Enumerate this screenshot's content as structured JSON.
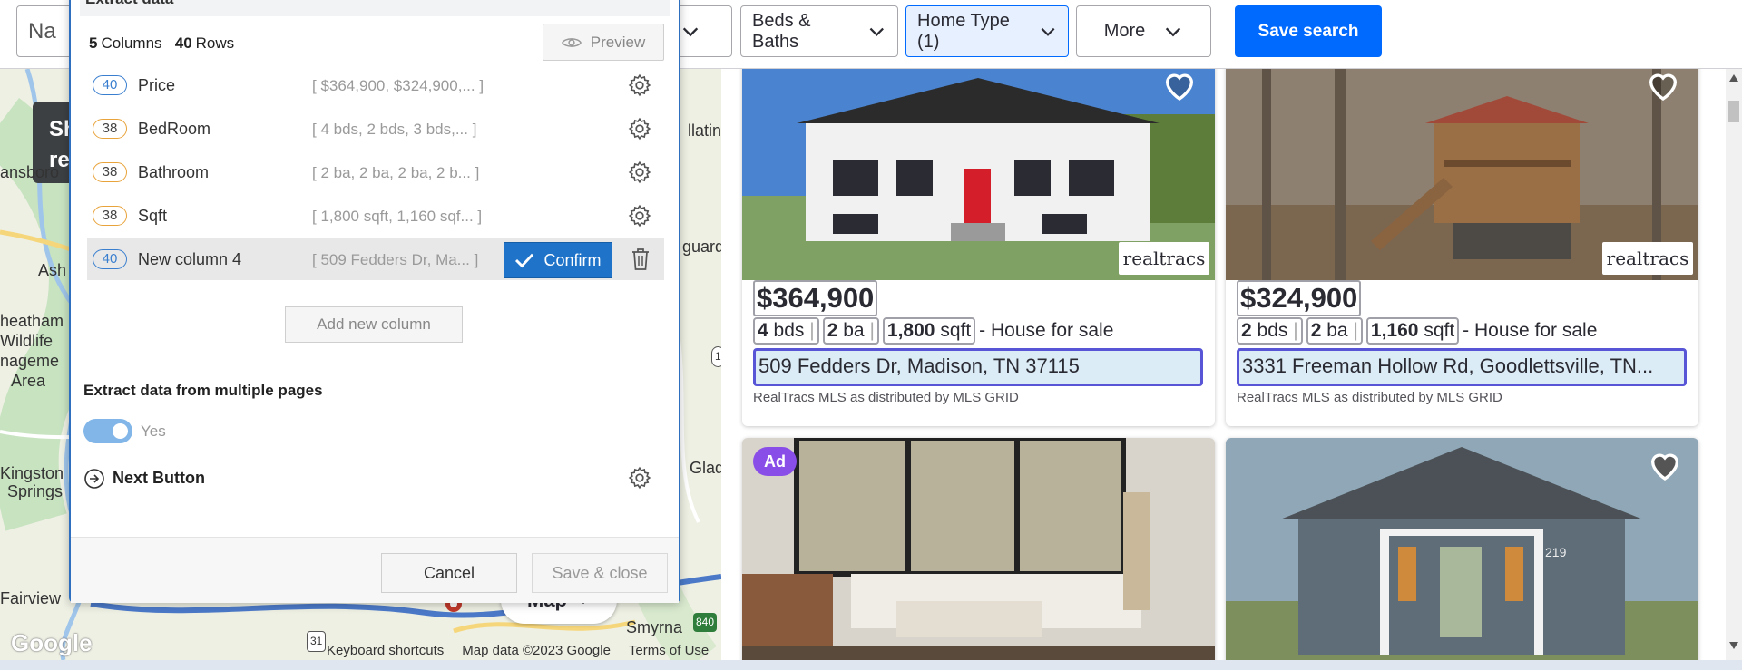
{
  "filters": {
    "location_partial": "Na",
    "beds_baths": "Beds & Baths",
    "home_type": "Home Type (1)",
    "more": "More",
    "save_search": "Save search"
  },
  "map": {
    "places": [
      "ansboro",
      "Ash",
      "heatham",
      "Wildlife",
      "nageme",
      "Area",
      "Kingston",
      "Springs",
      "Fairview",
      "llatin",
      "guard",
      "Glad",
      "Smyrna"
    ],
    "tooltip_lines": [
      "Sh",
      "re"
    ],
    "route_badges": [
      "31",
      "840",
      "1"
    ],
    "map_button": "Map",
    "google_logo": "Google",
    "credits": [
      "Keyboard shortcuts",
      "Map data ©2023 Google",
      "Terms of Use"
    ]
  },
  "listings": [
    {
      "price": "$364,900",
      "beds": "4",
      "beds_unit": "bds",
      "baths": "2",
      "baths_unit": "ba",
      "sqft": "1,800",
      "sqft_unit": "sqft",
      "status": "- House for sale",
      "address": "509 Fedders Dr, Madison, TN 37115",
      "mls": "RealTracs MLS as distributed by MLS GRID",
      "brand": "realtracs",
      "icon": "heart-outline-icon"
    },
    {
      "price": "$324,900",
      "beds": "2",
      "beds_unit": "bds",
      "baths": "2",
      "baths_unit": "ba",
      "sqft": "1,160",
      "sqft_unit": "sqft",
      "status": "- House for sale",
      "address": "3331 Freeman Hollow Rd, Goodlettsville, TN...",
      "mls": "RealTracs MLS as distributed by MLS GRID",
      "brand": "realtracs",
      "icon": "heart-outline-icon"
    },
    {
      "ad_badge": "Ad"
    },
    {
      "house_number": "219",
      "icon": "heart-filled-icon"
    }
  ],
  "panel": {
    "title": "Extract data",
    "columns_count": "5",
    "columns_label": "Columns",
    "rows_count": "40",
    "rows_label": "Rows",
    "preview": "Preview",
    "columns": [
      {
        "count": "40",
        "name": "Price",
        "sample": "[ $364,900, $324,900,... ]",
        "color": "#3a7fcf"
      },
      {
        "count": "38",
        "name": "BedRoom",
        "sample": "[ 4 bds, 2 bds, 3 bds,... ]",
        "color": "#e8a33a"
      },
      {
        "count": "38",
        "name": "Bathroom",
        "sample": "[ 2 ba, 2 ba, 2 ba, 2 b... ]",
        "color": "#e8a33a"
      },
      {
        "count": "38",
        "name": "Sqft",
        "sample": "[ 1,800 sqft, 1,160 sqf... ]",
        "color": "#e8a33a"
      },
      {
        "count": "40",
        "name": "New column 4",
        "sample": "[ 509 Fedders Dr, Ma... ]",
        "color": "#3a7fcf"
      }
    ],
    "confirm": "Confirm",
    "add_column": "Add new column",
    "multi_pages_label": "Extract data from multiple pages",
    "toggle_label": "Yes",
    "toggle_on": true,
    "next_button": "Next Button",
    "cancel": "Cancel",
    "save_close": "Save & close"
  },
  "colors": {
    "accent": "#006aff",
    "panel_border": "#2f6fbf",
    "confirm": "#1f73c8",
    "ad": "#8a4ee8",
    "address_outline": "#5856d6"
  }
}
